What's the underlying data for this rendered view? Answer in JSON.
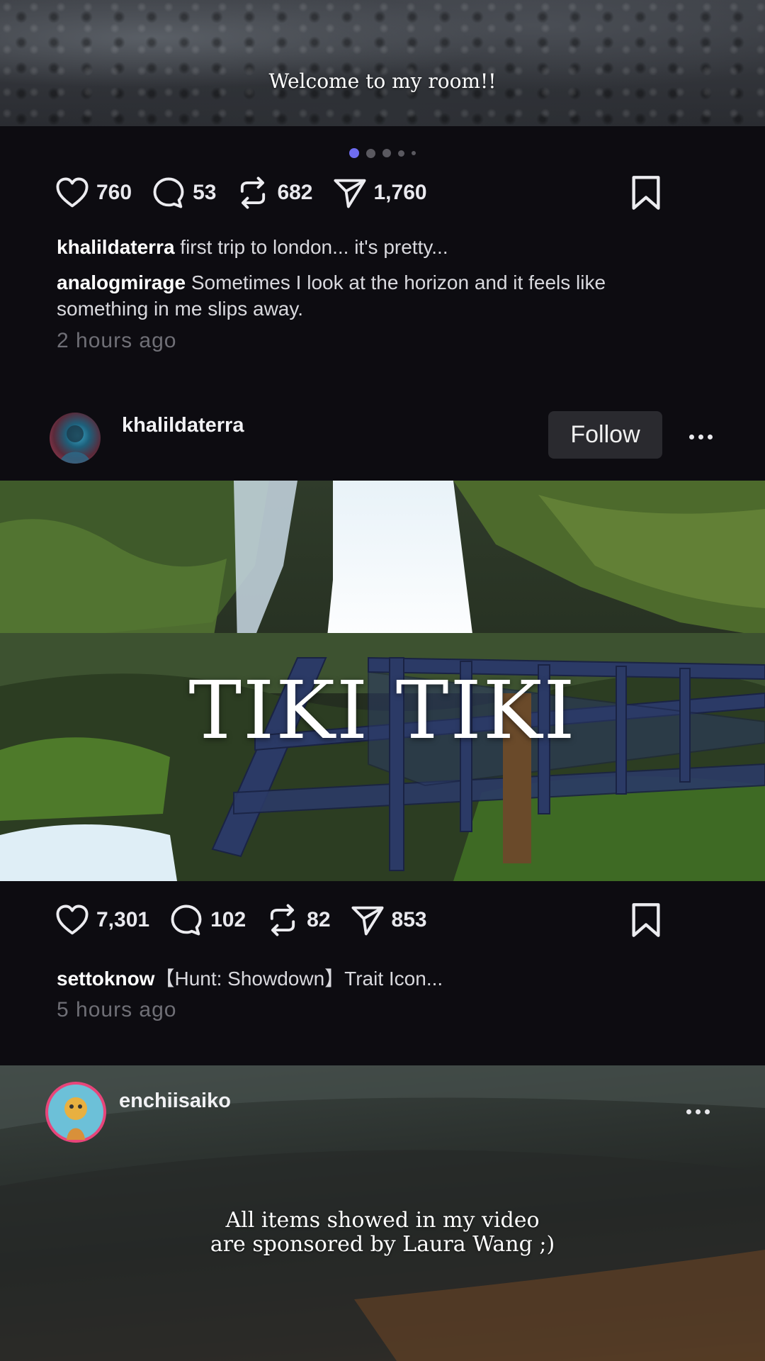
{
  "post1": {
    "overlay_text": "Welcome to my room!!",
    "carousel": {
      "count": 5,
      "active_index": 0
    },
    "stats": {
      "likes": "760",
      "comments": "53",
      "reposts": "682",
      "shares": "1,760"
    },
    "caption_user": "khalildaterra",
    "caption_text": " first trip to london... it's pretty...",
    "comment_user": "analogmirage",
    "comment_text": " Sometimes I look at the horizon and it feels like something in me slips away.",
    "time": "2 hours ago"
  },
  "post2": {
    "username": "khalildaterra",
    "follow_label": "Follow",
    "media_title": "TIKI TIKI",
    "stats": {
      "likes": "7,301",
      "comments": "102",
      "reposts": "82",
      "shares": "853"
    },
    "caption_user": "settoknow",
    "caption_text": "【Hunt: Showdown】Trait Icon...",
    "time": "5 hours ago"
  },
  "post3": {
    "username": "enchiisaiko",
    "overlay_line1": "All items showed in my video",
    "overlay_line2": "are sponsored by Laura Wang ;)"
  },
  "colors": {
    "background": "#0d0c11",
    "accent": "#6e6cf0",
    "follow_bg": "#2a2a2f",
    "muted_text": "#6f6f76"
  },
  "icons": [
    "heart-icon",
    "comment-icon",
    "repost-icon",
    "share-icon",
    "bookmark-icon",
    "more-icon"
  ]
}
